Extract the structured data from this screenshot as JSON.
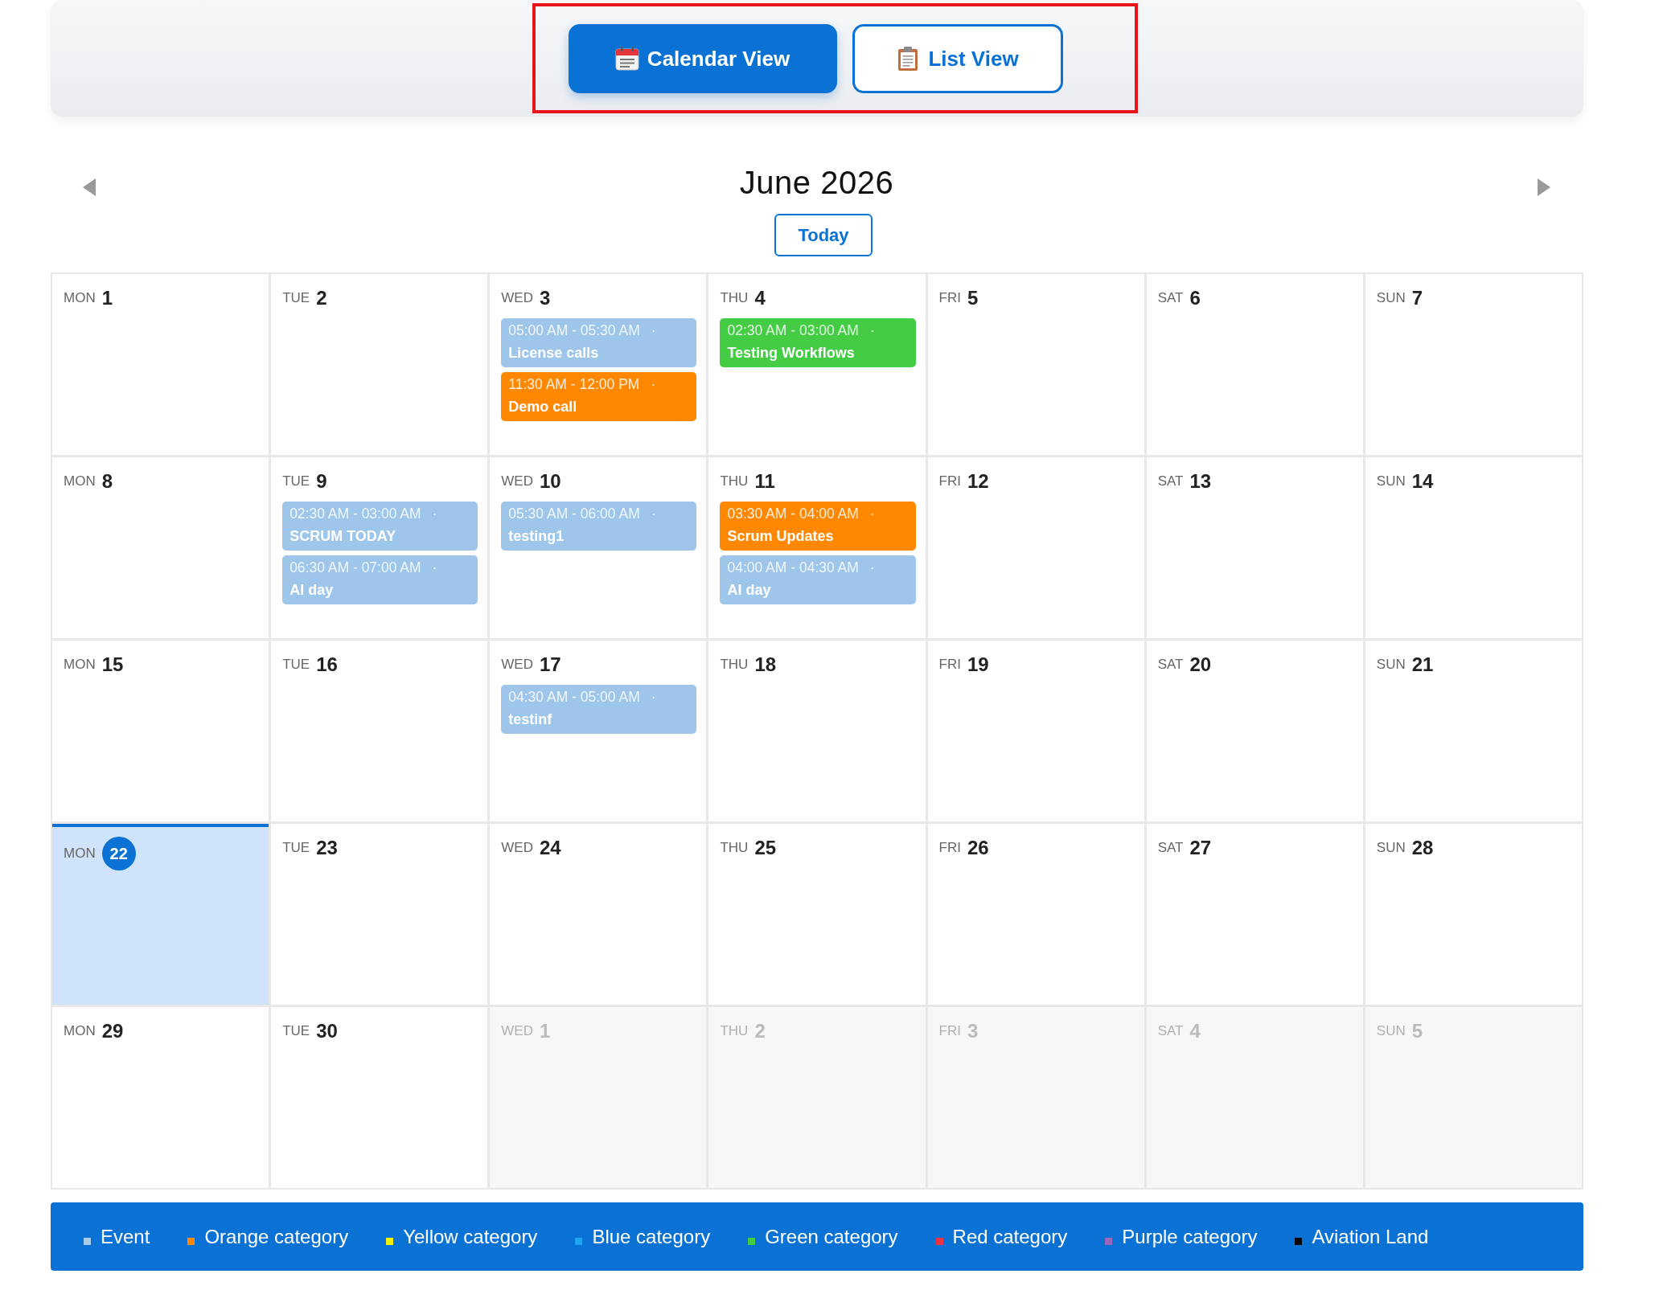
{
  "view_switcher": {
    "highlighted": true,
    "buttons": [
      {
        "kind": "calendar",
        "label": "Calendar View",
        "selected": true
      },
      {
        "kind": "list",
        "label": "List View",
        "selected": false
      }
    ]
  },
  "calendar": {
    "title": "June 2026",
    "today_button": "Today",
    "days": [
      {
        "weekday": "MON",
        "day": "1",
        "in_month": true,
        "today": false
      },
      {
        "weekday": "TUE",
        "day": "2",
        "in_month": true,
        "today": false
      },
      {
        "weekday": "WED",
        "day": "3",
        "in_month": true,
        "today": false,
        "events": [
          {
            "time": "05:00 AM - 05:30 AM",
            "separator": "·",
            "title": "License calls",
            "color": "#9dc6ea"
          },
          {
            "time": "11:30 AM - 12:00 PM",
            "separator": "·",
            "title": "Demo call",
            "color": "#ff8800"
          }
        ]
      },
      {
        "weekday": "THU",
        "day": "4",
        "in_month": true,
        "today": false,
        "events": [
          {
            "time": "02:30 AM - 03:00 AM",
            "separator": "·",
            "title": "Testing Workflows",
            "color": "#44cc44"
          }
        ]
      },
      {
        "weekday": "FRI",
        "day": "5",
        "in_month": true,
        "today": false
      },
      {
        "weekday": "SAT",
        "day": "6",
        "in_month": true,
        "today": false
      },
      {
        "weekday": "SUN",
        "day": "7",
        "in_month": true,
        "today": false
      },
      {
        "weekday": "MON",
        "day": "8",
        "in_month": true,
        "today": false
      },
      {
        "weekday": "TUE",
        "day": "9",
        "in_month": true,
        "today": false,
        "events": [
          {
            "time": "02:30 AM - 03:00 AM",
            "separator": "·",
            "title": "SCRUM TODAY",
            "color": "#9dc6ea"
          },
          {
            "time": "06:30 AM - 07:00 AM",
            "separator": "·",
            "title": "AI day",
            "color": "#9dc6ea"
          }
        ]
      },
      {
        "weekday": "WED",
        "day": "10",
        "in_month": true,
        "today": false,
        "events": [
          {
            "time": "05:30 AM - 06:00 AM",
            "separator": "·",
            "title": "testing1",
            "color": "#9dc6ea"
          }
        ]
      },
      {
        "weekday": "THU",
        "day": "11",
        "in_month": true,
        "today": false,
        "events": [
          {
            "time": "03:30 AM - 04:00 AM",
            "separator": "·",
            "title": "Scrum Updates",
            "color": "#ff8800"
          },
          {
            "time": "04:00 AM - 04:30 AM",
            "separator": "·",
            "title": "AI day",
            "color": "#9dc6ea"
          }
        ]
      },
      {
        "weekday": "FRI",
        "day": "12",
        "in_month": true,
        "today": false
      },
      {
        "weekday": "SAT",
        "day": "13",
        "in_month": true,
        "today": false
      },
      {
        "weekday": "SUN",
        "day": "14",
        "in_month": true,
        "today": false
      },
      {
        "weekday": "MON",
        "day": "15",
        "in_month": true,
        "today": false
      },
      {
        "weekday": "TUE",
        "day": "16",
        "in_month": true,
        "today": false
      },
      {
        "weekday": "WED",
        "day": "17",
        "in_month": true,
        "today": false,
        "events": [
          {
            "time": "04:30 AM - 05:00 AM",
            "separator": "·",
            "title": "testinf",
            "color": "#9dc6ea"
          }
        ]
      },
      {
        "weekday": "THU",
        "day": "18",
        "in_month": true,
        "today": false
      },
      {
        "weekday": "FRI",
        "day": "19",
        "in_month": true,
        "today": false
      },
      {
        "weekday": "SAT",
        "day": "20",
        "in_month": true,
        "today": false
      },
      {
        "weekday": "SUN",
        "day": "21",
        "in_month": true,
        "today": false
      },
      {
        "weekday": "MON",
        "day": "22",
        "in_month": true,
        "today": true
      },
      {
        "weekday": "TUE",
        "day": "23",
        "in_month": true,
        "today": false
      },
      {
        "weekday": "WED",
        "day": "24",
        "in_month": true,
        "today": false
      },
      {
        "weekday": "THU",
        "day": "25",
        "in_month": true,
        "today": false
      },
      {
        "weekday": "FRI",
        "day": "26",
        "in_month": true,
        "today": false
      },
      {
        "weekday": "SAT",
        "day": "27",
        "in_month": true,
        "today": false
      },
      {
        "weekday": "SUN",
        "day": "28",
        "in_month": true,
        "today": false
      },
      {
        "weekday": "MON",
        "day": "29",
        "in_month": true,
        "today": false
      },
      {
        "weekday": "TUE",
        "day": "30",
        "in_month": true,
        "today": false
      },
      {
        "weekday": "WED",
        "day": "1",
        "in_month": false,
        "today": false
      },
      {
        "weekday": "THU",
        "day": "2",
        "in_month": false,
        "today": false
      },
      {
        "weekday": "FRI",
        "day": "3",
        "in_month": false,
        "today": false
      },
      {
        "weekday": "SAT",
        "day": "4",
        "in_month": false,
        "today": false
      },
      {
        "weekday": "SUN",
        "day": "5",
        "in_month": false,
        "today": false
      }
    ]
  },
  "legend": [
    {
      "label": "Event",
      "color": "#a8cdea"
    },
    {
      "label": "Orange category",
      "color": "#ff8800"
    },
    {
      "label": "Yellow category",
      "color": "#f2f20a"
    },
    {
      "label": "Blue category",
      "color": "#1aa7f0"
    },
    {
      "label": "Green category",
      "color": "#44cc44"
    },
    {
      "label": "Red category",
      "color": "#ee3344"
    },
    {
      "label": "Purple category",
      "color": "#9966bb"
    },
    {
      "label": "Aviation Land",
      "color": "#000000"
    }
  ]
}
